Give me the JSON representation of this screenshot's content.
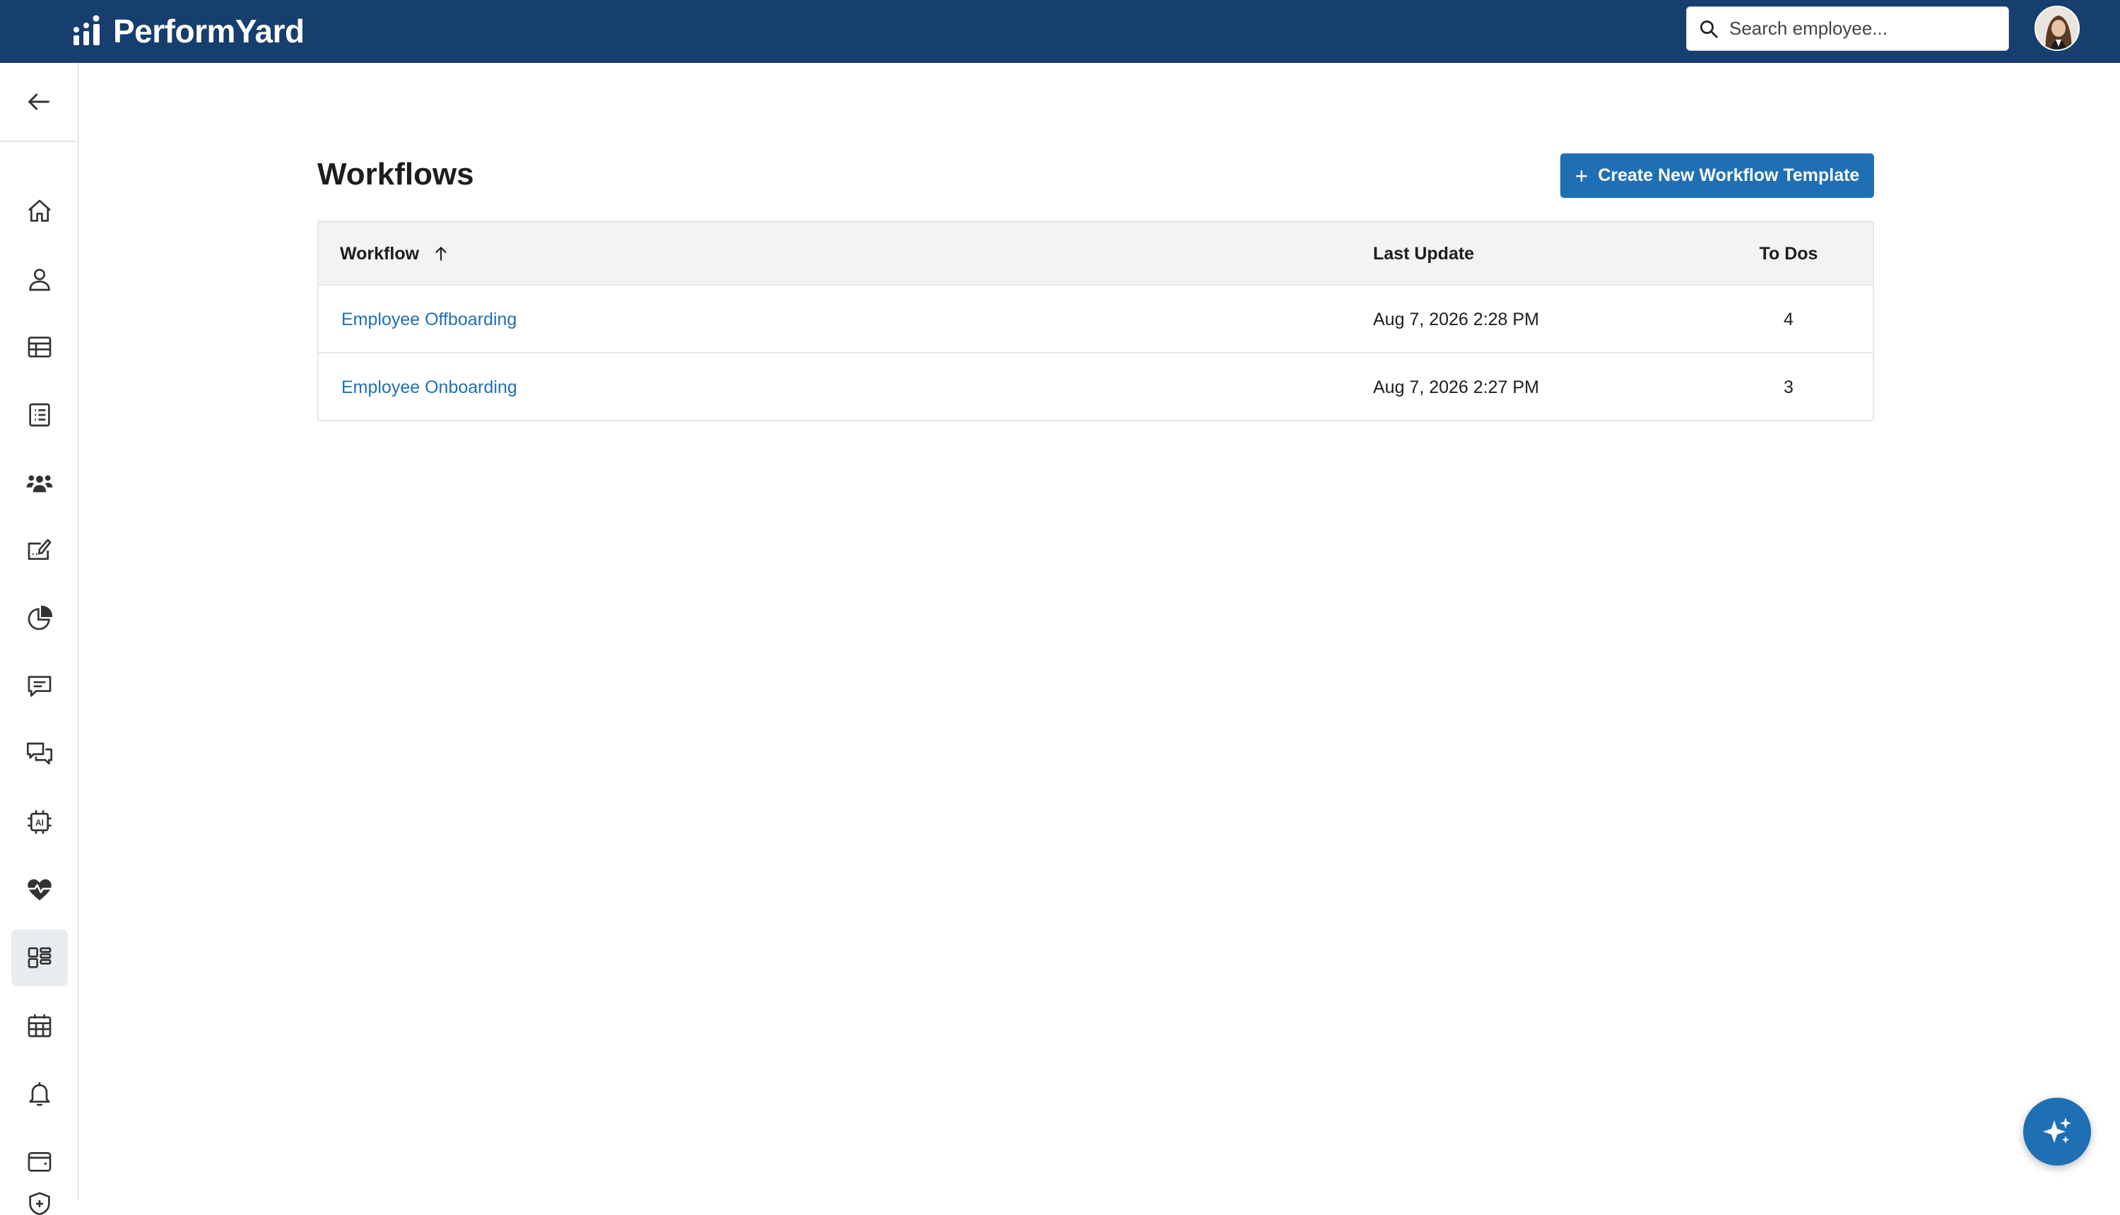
{
  "app": {
    "brand_name": "PerformYard",
    "brand_color": "#163e6e",
    "accent_color": "#1f6fb5"
  },
  "header": {
    "search_placeholder": "Search employee...",
    "avatar_icon": "user-avatar"
  },
  "sidebar": {
    "back_icon": "arrow-left-icon",
    "items": [
      {
        "icon": "home-icon"
      },
      {
        "icon": "person-icon"
      },
      {
        "icon": "table-icon"
      },
      {
        "icon": "checklist-icon"
      },
      {
        "icon": "team-icon"
      },
      {
        "icon": "edit-form-icon"
      },
      {
        "icon": "pie-chart-icon"
      },
      {
        "icon": "message-icon"
      },
      {
        "icon": "conversation-icon"
      },
      {
        "icon": "ai-chip-icon"
      },
      {
        "icon": "heart-pulse-icon"
      },
      {
        "icon": "workflows-icon",
        "active": true
      },
      {
        "icon": "calendar-icon"
      },
      {
        "icon": "bell-icon"
      },
      {
        "icon": "wallet-icon"
      },
      {
        "icon": "shield-plus-icon"
      }
    ]
  },
  "main": {
    "title": "Workflows",
    "create_button": "Create New Workflow Template",
    "table": {
      "columns": [
        "Workflow",
        "Last Update",
        "To Dos"
      ],
      "rows": [
        {
          "workflow": "Employee Offboarding",
          "last_update": "Aug 7, 2026 2:28 PM",
          "todos": "4"
        },
        {
          "workflow": "Employee Onboarding",
          "last_update": "Aug 7, 2026 2:27 PM",
          "todos": "3"
        }
      ]
    }
  },
  "fab": {
    "icon": "sparkle-icon"
  }
}
